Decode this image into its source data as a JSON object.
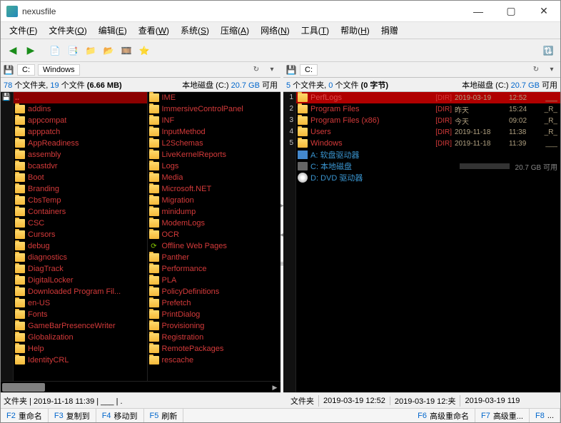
{
  "window": {
    "title": "nexusfile"
  },
  "menu": [
    {
      "label": "文件",
      "hotkey": "F"
    },
    {
      "label": "文件夹",
      "hotkey": "O"
    },
    {
      "label": "编辑",
      "hotkey": "E"
    },
    {
      "label": "查看",
      "hotkey": "W"
    },
    {
      "label": "系统",
      "hotkey": "S"
    },
    {
      "label": "压缩",
      "hotkey": "A"
    },
    {
      "label": "网络",
      "hotkey": "N"
    },
    {
      "label": "工具",
      "hotkey": "T"
    },
    {
      "label": "帮助",
      "hotkey": "H"
    },
    {
      "label": "捐赠",
      "hotkey": ""
    }
  ],
  "left": {
    "breadcrumb": [
      "C:",
      "Windows"
    ],
    "status_folders": "78",
    "status_folders_suffix": " 个文件夹, ",
    "status_files": "19",
    "status_files_suffix": " 个文件 ",
    "status_size": "(6.66 MB)",
    "disk_label": "本地磁盘 (C:) ",
    "disk_free": "20.7 GB",
    "disk_free_suffix": " 可用",
    "parent": "..",
    "col1": [
      "addins",
      "appcompat",
      "apppatch",
      "AppReadiness",
      "assembly",
      "bcastdvr",
      "Boot",
      "Branding",
      "CbsTemp",
      "Containers",
      "CSC",
      "Cursors",
      "debug",
      "diagnostics",
      "DiagTrack",
      "DigitalLocker",
      "Downloaded Program Fil...",
      "en-US",
      "Fonts",
      "GameBarPresenceWriter",
      "Globalization",
      "Help",
      "IdentityCRL"
    ],
    "col2": [
      "IME",
      "ImmersiveControlPanel",
      "INF",
      "InputMethod",
      "L2Schemas",
      "LiveKernelReports",
      "Logs",
      "Media",
      "Microsoft.NET",
      "Migration",
      "minidump",
      "ModemLogs",
      "OCR",
      "Offline Web Pages",
      "Panther",
      "Performance",
      "PLA",
      "PolicyDefinitions",
      "Prefetch",
      "PrintDialog",
      "Provisioning",
      "Registration",
      "RemotePackages",
      "rescache"
    ],
    "bottom": "文件夹 | 2019-11-18 11:39 | ___ | . "
  },
  "right": {
    "breadcrumb": [
      "C:"
    ],
    "status_folders": "5",
    "status_folders_suffix": " 个文件夹, ",
    "status_files": "0",
    "status_files_suffix": " 个文件 ",
    "status_size": "(0 字节)",
    "disk_label": "本地磁盘 (C:) ",
    "disk_free": "20.7 GB",
    "disk_free_suffix": " 可用",
    "rows": [
      {
        "name": "PerfLogs",
        "dir": "[DIR]",
        "date": "2019-03-19",
        "time": "12:52",
        "attr": "___",
        "sel": true
      },
      {
        "name": "Program Files",
        "dir": "[DIR]",
        "date": "昨天",
        "time": "15:24",
        "attr": "_R_"
      },
      {
        "name": "Program Files (x86)",
        "dir": "[DIR]",
        "date": "今天",
        "time": "09:02",
        "attr": "_R_"
      },
      {
        "name": "Users",
        "dir": "[DIR]",
        "date": "2019-11-18",
        "time": "11:38",
        "attr": "_R_"
      },
      {
        "name": "Windows",
        "dir": "[DIR]",
        "date": "2019-11-18",
        "time": "11:39",
        "attr": "___"
      }
    ],
    "drives": [
      {
        "icon": "floppy",
        "label": "A: 软盘驱动器"
      },
      {
        "icon": "disk",
        "label": "C: 本地磁盘",
        "usage": 35,
        "free": "20.7 GB 可用"
      },
      {
        "icon": "dvd",
        "label": "D: DVD 驱动器"
      }
    ],
    "gutter": [
      "1",
      "2",
      "3",
      "4",
      "5"
    ],
    "bottom_segs": [
      "文件夹",
      "2019-03-19 12:52",
      "2019-03-19 12:夹",
      "2019-03-19 119"
    ]
  },
  "fnbar": [
    {
      "key": "F2",
      "label": "重命名"
    },
    {
      "key": "F3",
      "label": "复制到"
    },
    {
      "key": "F4",
      "label": "移动到"
    },
    {
      "key": "F5",
      "label": "刷新"
    },
    {
      "gap": true
    },
    {
      "key": "F6",
      "label": "高级重命名"
    },
    {
      "key": "F7",
      "label": "高级重..."
    },
    {
      "key": "F8",
      "label": "..."
    }
  ]
}
